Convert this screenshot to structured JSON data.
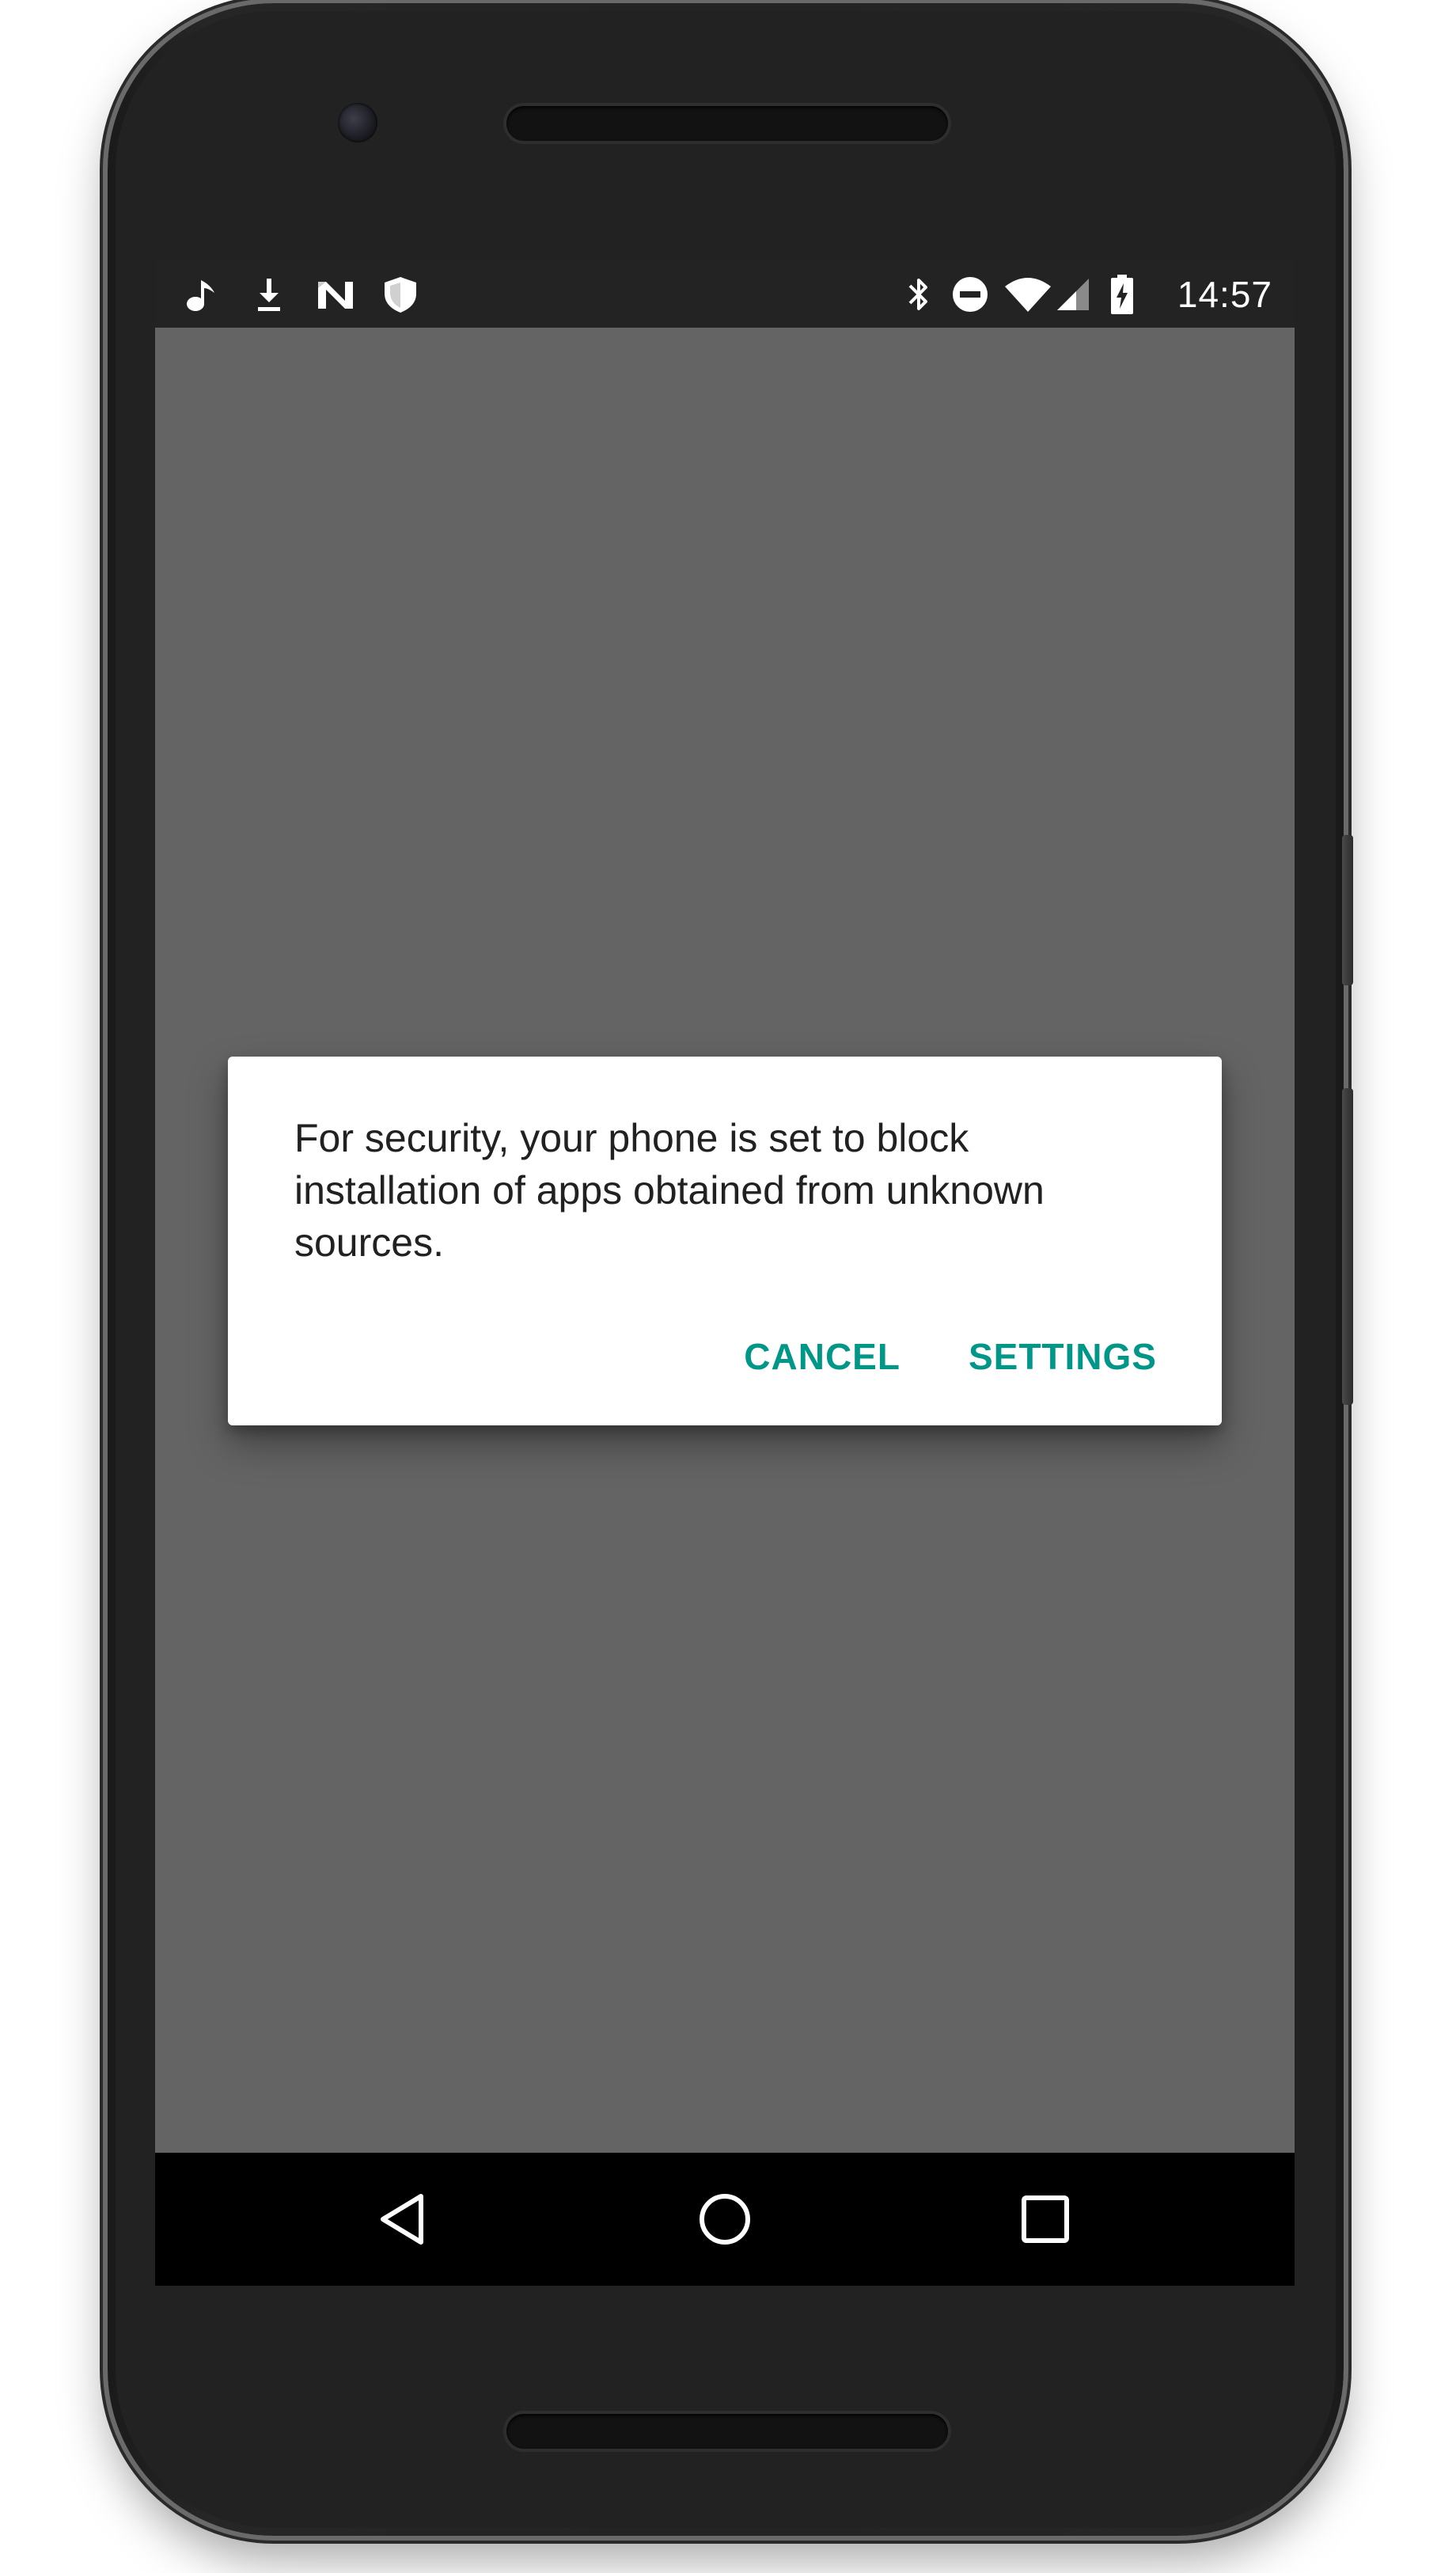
{
  "status_bar": {
    "time": "14:57",
    "left_icons": [
      "music-note-icon",
      "download-icon",
      "n-logo-icon",
      "shield-icon"
    ],
    "right_icons": [
      "bluetooth-icon",
      "do-not-disturb-icon",
      "wifi-icon",
      "cell-signal-icon",
      "battery-charging-icon"
    ]
  },
  "dialog": {
    "message": "For security, your phone is set to block installation of apps obtained from unknown sources.",
    "cancel_label": "CANCEL",
    "settings_label": "SETTINGS",
    "accent_color": "#009688"
  },
  "nav_bar": {
    "buttons": [
      "back-icon",
      "home-icon",
      "recents-icon"
    ]
  },
  "colors": {
    "screen_background": "#646464",
    "status_bar": "#232323",
    "nav_bar": "#000000"
  }
}
